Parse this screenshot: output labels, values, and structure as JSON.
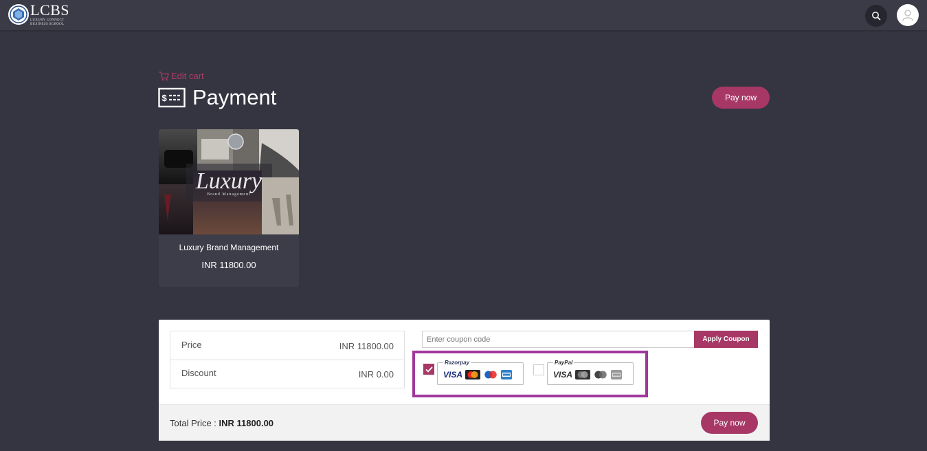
{
  "header": {
    "logo_title": "LCBS",
    "logo_sub_line1": "LUXURY CONNECT",
    "logo_sub_line2": "BUSINESS SCHOOL"
  },
  "page": {
    "edit_cart_label": "Edit cart",
    "title": "Payment",
    "pay_now_label": "Pay now"
  },
  "product": {
    "image_text": "Luxury",
    "image_subtext": "Brand Management",
    "name": "Luxury Brand Management",
    "price": "INR 11800.00"
  },
  "summary": {
    "price_label": "Price",
    "price_value": "INR 11800.00",
    "discount_label": "Discount",
    "discount_value": "INR 0.00",
    "total_label": "Total Price : ",
    "total_value": "INR 11800.00",
    "pay_now_label": "Pay now"
  },
  "coupon": {
    "placeholder": "Enter coupon code",
    "apply_label": "Apply Coupon"
  },
  "payment_methods": {
    "razorpay": {
      "brand": "Razorpay",
      "visa": "VISA",
      "selected": true
    },
    "paypal": {
      "brand": "PayPal",
      "visa": "VISA",
      "selected": false
    }
  },
  "colors": {
    "accent": "#a73866",
    "background": "#353541",
    "highlight_border": "#a0389b"
  }
}
